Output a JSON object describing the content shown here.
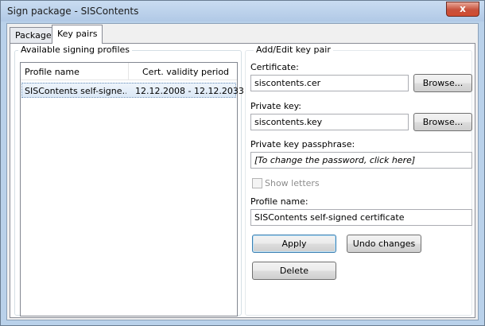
{
  "window": {
    "title": "Sign package - SISContents",
    "close_glyph": "x"
  },
  "tabs": [
    {
      "label": "Package",
      "active": false
    },
    {
      "label": "Key pairs",
      "active": true
    }
  ],
  "profiles_group": {
    "caption": "Available signing profiles",
    "columns": [
      "Profile name",
      "Cert. validity period"
    ],
    "rows": [
      {
        "profile_name": "SISContents self-signe…",
        "validity": "12.12.2008 - 12.12.2033",
        "selected": true
      }
    ]
  },
  "edit_group": {
    "caption": "Add/Edit key pair",
    "certificate_label": "Certificate:",
    "certificate_value": "siscontents.cer",
    "private_key_label": "Private key:",
    "private_key_value": "siscontents.key",
    "browse_label": "Browse...",
    "passphrase_label": "Private key passphrase:",
    "passphrase_value": "[To change the password, click here]",
    "show_letters_label": "Show letters",
    "show_letters_checked": false,
    "profile_name_label": "Profile name:",
    "profile_name_value": "SISContents self-signed certificate",
    "apply_label": "Apply",
    "undo_label": "Undo changes",
    "delete_label": "Delete"
  }
}
